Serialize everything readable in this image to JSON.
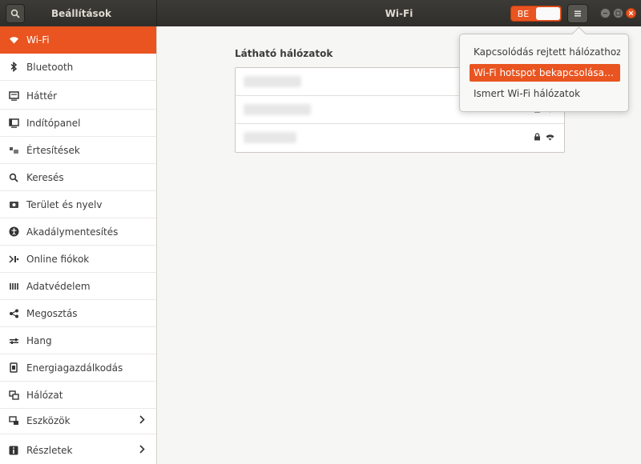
{
  "window": {
    "sidebar_title": "Beállítások",
    "panel_title": "Wi-Fi",
    "toggle_label": "BE",
    "toggle_on": true
  },
  "sidebar": {
    "items": [
      {
        "label": "Wi-Fi",
        "icon": "wifi-icon",
        "active": true
      },
      {
        "label": "Bluetooth",
        "icon": "bluetooth-icon"
      },
      {
        "label": "Háttér",
        "icon": "background-icon"
      },
      {
        "label": "Indítópanel",
        "icon": "dock-icon"
      },
      {
        "label": "Értesítések",
        "icon": "notifications-icon"
      },
      {
        "label": "Keresés",
        "icon": "search-icon"
      },
      {
        "label": "Terület és nyelv",
        "icon": "region-icon"
      },
      {
        "label": "Akadálymentesítés",
        "icon": "accessibility-icon"
      },
      {
        "label": "Online fiókok",
        "icon": "online-accounts-icon"
      },
      {
        "label": "Adatvédelem",
        "icon": "privacy-icon"
      },
      {
        "label": "Megosztás",
        "icon": "share-icon"
      },
      {
        "label": "Hang",
        "icon": "sound-icon"
      },
      {
        "label": "Energiagazdálkodás",
        "icon": "power-icon"
      },
      {
        "label": "Hálózat",
        "icon": "network-icon"
      },
      {
        "label": "Eszközök",
        "icon": "devices-icon",
        "has_submenu": true
      },
      {
        "label": "Részletek",
        "icon": "details-icon",
        "has_submenu": true
      }
    ]
  },
  "main": {
    "section_title": "Látható hálózatok",
    "networks": [
      {
        "name": "████████",
        "secured": false
      },
      {
        "name": "████████",
        "secured": true
      },
      {
        "name": "███████",
        "secured": true
      }
    ]
  },
  "menu": {
    "items": [
      {
        "label": "Kapcsolódás rejtett hálózathoz…"
      },
      {
        "label": "Wi-Fi hotspot bekapcsolása…",
        "highlighted": true
      },
      {
        "label": "Ismert Wi-Fi hálózatok"
      }
    ]
  },
  "colors": {
    "accent": "#e95420",
    "titlebar": "#3c3b37"
  }
}
